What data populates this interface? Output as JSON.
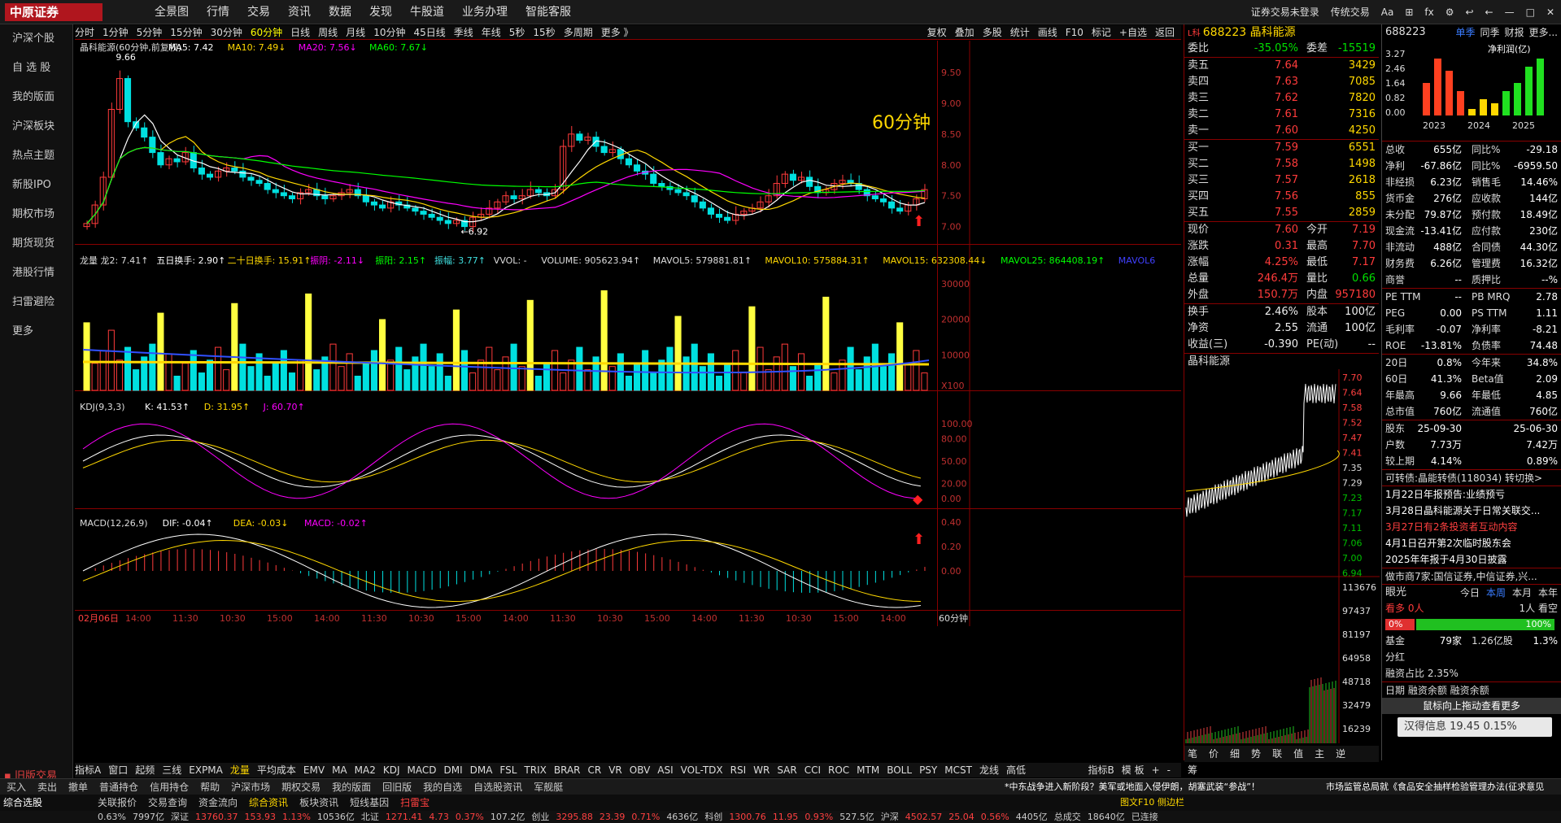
{
  "topbar": {
    "logo": "中原证券",
    "menu": [
      "全景图",
      "行情",
      "交易",
      "资讯",
      "数据",
      "发现",
      "牛股道",
      "业务办理",
      "智能客服"
    ],
    "right": [
      "证券交易未登录",
      "传统交易",
      "Aa",
      "⊞",
      "fx",
      "⚙",
      "↩",
      "←",
      "—",
      "□",
      "✕"
    ]
  },
  "sidebar": {
    "items": [
      "沪深个股",
      "自 选 股",
      "我的版面",
      "沪深板块",
      "热点主题",
      "新股IPO",
      "期权市场",
      "期货现货",
      "港股行情",
      "扫雷避险",
      "更多"
    ],
    "old_version": "旧版交易"
  },
  "periods": [
    "分时",
    "1分钟",
    "5分钟",
    "15分钟",
    "30分钟",
    "60分钟",
    "日线",
    "周线",
    "月线",
    "10分钟",
    "45日线",
    "季线",
    "年线",
    "5秒",
    "15秒",
    "多周期",
    "更多 》"
  ],
  "active_period": "60分钟",
  "tools": [
    "复权",
    "叠加",
    "多股",
    "统计",
    "画线",
    "F10",
    "标记",
    "+自选",
    "返回"
  ],
  "main_chart": {
    "title": "晶科能源(60分钟,前复权)",
    "ma5": "MA5: 7.42",
    "ma10": "MA10: 7.49↓",
    "ma20": "MA20: 7.56↓",
    "ma60": "MA60: 7.67↓",
    "big_label": "60分钟",
    "high_mark": "9.66",
    "low_mark": "6.92",
    "price_ticks": [
      "9.50",
      "9.00",
      "8.50",
      "8.00",
      "7.50",
      "7.00"
    ]
  },
  "vol_chart": {
    "header": [
      "龙量 龙2: 7.41↑",
      "五日换手: 2.90↑",
      "二十日换手: 15.91↑",
      "振阴: -2.11↓",
      "振阳: 2.15↑",
      "振幅: 3.77↑",
      "VVOL: -",
      "VOLUME: 905623.94↑",
      "MAVOL5: 579881.81↑",
      "MAVOL10: 575884.31↑",
      "MAVOL15: 632308.44↓",
      "MAVOL25: 864408.19↑",
      "MAVOL6"
    ],
    "ticks": [
      "30000",
      "20000",
      "10000"
    ],
    "unit": "X100"
  },
  "kdj": {
    "header": "KDJ(9,3,3)",
    "k": "K: 41.53↑",
    "d": "D: 31.95↑",
    "j": "J: 60.70↑",
    "ticks": [
      "100.00",
      "80.00",
      "50.00",
      "20.00",
      "0.00"
    ]
  },
  "macd": {
    "header": "MACD(12,26,9)",
    "dif": "DIF: -0.04↑",
    "dea": "DEA: -0.03↓",
    "macd": "MACD: -0.02↑",
    "ticks": [
      "0.40",
      "0.20",
      "0.00"
    ]
  },
  "time_axis": [
    "02月06日",
    "14:00",
    "11:30",
    "10:30",
    "15:00",
    "14:00",
    "11:30",
    "10:30",
    "15:00",
    "14:00",
    "11:30",
    "10:30",
    "15:00",
    "14:00",
    "11:30",
    "10:30",
    "15:00",
    "14:00"
  ],
  "time_axis_right": "60分钟",
  "indicators": [
    "指标A",
    "窗口",
    "起频",
    "三线",
    "EXPMA",
    "龙量",
    "平均成本",
    "EMV",
    "MA",
    "MA2",
    "KDJ",
    "MACD",
    "DMI",
    "DMA",
    "FSL",
    "TRIX",
    "BRAR",
    "CR",
    "VR",
    "OBV",
    "ASI",
    "VOL-TDX",
    "RSI",
    "WR",
    "SAR",
    "CCI",
    "ROC",
    "MTM",
    "BOLL",
    "PSY",
    "MCST",
    "龙线",
    "高低"
  ],
  "indicators_right": [
    "指标B",
    "模 板",
    "+",
    "-"
  ],
  "quote": {
    "code_name": "688223 晶科能源",
    "weibi": [
      "委比",
      "-35.05%",
      "委差",
      "-15519"
    ],
    "sell": [
      [
        "卖五",
        "7.64",
        "3429"
      ],
      [
        "卖四",
        "7.63",
        "7085"
      ],
      [
        "卖三",
        "7.62",
        "7820"
      ],
      [
        "卖二",
        "7.61",
        "7316"
      ],
      [
        "卖一",
        "7.60",
        "4250"
      ]
    ],
    "buy": [
      [
        "买一",
        "7.59",
        "6551"
      ],
      [
        "买二",
        "7.58",
        "1498"
      ],
      [
        "买三",
        "7.57",
        "2618"
      ],
      [
        "买四",
        "7.56",
        "855"
      ],
      [
        "买五",
        "7.55",
        "2859"
      ]
    ],
    "stats": [
      [
        "现价",
        "7.60",
        "今开",
        "7.19"
      ],
      [
        "涨跌",
        "0.31",
        "最高",
        "7.70"
      ],
      [
        "涨幅",
        "4.25%",
        "最低",
        "7.17"
      ],
      [
        "总量",
        "246.4万",
        "量比",
        "0.66"
      ],
      [
        "外盘",
        "150.7万",
        "内盘",
        "957180"
      ]
    ],
    "stats2": [
      [
        "换手",
        "2.46%",
        "股本",
        "100亿"
      ],
      [
        "净资",
        "2.55",
        "流通",
        "100亿"
      ],
      [
        "收益(三)",
        "-0.390",
        "PE(动)",
        "--"
      ]
    ],
    "mini_title": "晶科能源",
    "mini_ticks": [
      "7.70",
      "7.64",
      "7.58",
      "7.52",
      "7.47",
      "7.41",
      "7.35",
      "7.29",
      "7.23",
      "7.17",
      "7.11",
      "7.06",
      "7.00",
      "6.94"
    ],
    "vol_ticks": [
      "113676",
      "97437",
      "81197",
      "64958",
      "48718",
      "32479",
      "16239"
    ],
    "bottom_tabs": [
      "笔",
      "价",
      "细",
      "势",
      "联",
      "值",
      "主",
      "逆",
      "筹"
    ]
  },
  "fin": {
    "code": "688223",
    "tabs": [
      "单季",
      "同季",
      "财报",
      "更多..."
    ],
    "chart_title": "净利润(亿)",
    "yticks": [
      "3.27",
      "2.46",
      "1.64",
      "0.82",
      "0.00"
    ],
    "years": [
      "2023",
      "2024",
      "2025"
    ],
    "rows": [
      [
        "总收",
        "655亿",
        "同比%",
        "-29.18"
      ],
      [
        "净利",
        "-67.86亿",
        "同比%",
        "-6959.50"
      ],
      [
        "非经损",
        "6.23亿",
        "销售毛",
        "14.46%"
      ],
      [
        "货币金",
        "276亿",
        "应收款",
        "144亿"
      ],
      [
        "未分配",
        "79.87亿",
        "预付款",
        "18.49亿"
      ],
      [
        "现金流",
        "-13.41亿",
        "应付款",
        "230亿"
      ],
      [
        "非流动",
        "488亿",
        "合同债",
        "44.30亿"
      ],
      [
        "财务费",
        "6.26亿",
        "管理费",
        "16.32亿"
      ],
      [
        "商誉",
        "--",
        "质押比",
        "--%"
      ]
    ],
    "rows2": [
      [
        "PE TTM",
        "--",
        "PB MRQ",
        "2.78"
      ],
      [
        "PEG",
        "0.00",
        "PS TTM",
        "1.11"
      ],
      [
        "毛利率",
        "-0.07",
        "净利率",
        "-8.21"
      ],
      [
        "ROE",
        "-13.81%",
        "负债率",
        "74.48"
      ]
    ],
    "rows3": [
      [
        "20日",
        "0.8%",
        "今年来",
        "34.8%"
      ],
      [
        "60日",
        "41.3%",
        "Beta值",
        "2.09"
      ],
      [
        "年最高",
        "9.66",
        "年最低",
        "4.85"
      ],
      [
        "总市值",
        "760亿",
        "流通值",
        "760亿"
      ]
    ],
    "rows4": [
      [
        "股东",
        "25-09-30",
        "",
        "25-06-30"
      ],
      [
        "户数",
        "7.73万",
        "",
        "7.42万"
      ],
      [
        "较上期",
        "4.14%",
        "",
        "0.89%"
      ]
    ],
    "convertible": "可转债:晶能转债(118034) 转切换>",
    "news": [
      "1月22日年报预告:业绩预亏",
      "3月28日晶科能源关于日常关联交...",
      "3月27日有2条投资者互动内容",
      "4月1日召开第2次临时股东会",
      "2025年年报于4月30日披露"
    ],
    "makers": "做市商7家:国信证券,中信证券,兴...",
    "eye": "眼光",
    "eye_tabs": [
      "今日",
      "本周",
      "本月",
      "本年"
    ],
    "bulls": "看多 0人",
    "bears": "1人 看空",
    "bull_pct": "0%",
    "bear_pct": "100%",
    "fund": [
      "基金",
      "79家",
      "1.26亿股",
      "1.3%"
    ],
    "tip": "汉得信息 19.45  0.15%",
    "fenhong": "分红",
    "capital": "融资占比 2.35%",
    "date_row": "日期  融资余额  融资余额",
    "bottom_hint": "鼠标向上拖动查看更多"
  },
  "bottom": {
    "row1": [
      "买入",
      "卖出",
      "撤单",
      "普通持仓",
      "信用持仓",
      "帮助",
      "沪深市场",
      "期权交易",
      "我的版面",
      "回旧版",
      "我的自选",
      "自选股资讯",
      "军舰艇"
    ],
    "row1_right": "*中东战争进入新阶段？美军或地面入侵伊朗，胡塞武装“参战”！",
    "row1_far": "市场监管总局就《食品安全抽样检验管理办法(征求意见",
    "row2_left": "综合选股",
    "row2": [
      "关联报价",
      "交易查询",
      "资金流向",
      "综合资讯",
      "板块资讯",
      "短线基因",
      "扫雷宝"
    ],
    "row2_right": "图文F10 侧边栏",
    "row3": [
      "0.63%",
      "7997亿",
      "深证",
      "13760.37",
      "153.93",
      "1.13%",
      "10536亿",
      "北证",
      "1271.41",
      "4.73",
      "0.37%",
      "107.2亿",
      "创业",
      "3295.88",
      "23.39",
      "0.71%",
      "4636亿",
      "科创",
      "1300.76",
      "11.95",
      "0.93%",
      "527.5亿",
      "沪深",
      "4502.57",
      "25.04",
      "0.56%",
      "4405亿",
      "总成交",
      "18640亿",
      "已连接"
    ]
  },
  "colors": {
    "up": "#ff3b3b",
    "down": "#00e0e0",
    "ma5": "#ffffff",
    "ma10": "#ffd800",
    "ma20": "#ff00ff",
    "ma60": "#00ff00",
    "accent": "#ffd800"
  }
}
